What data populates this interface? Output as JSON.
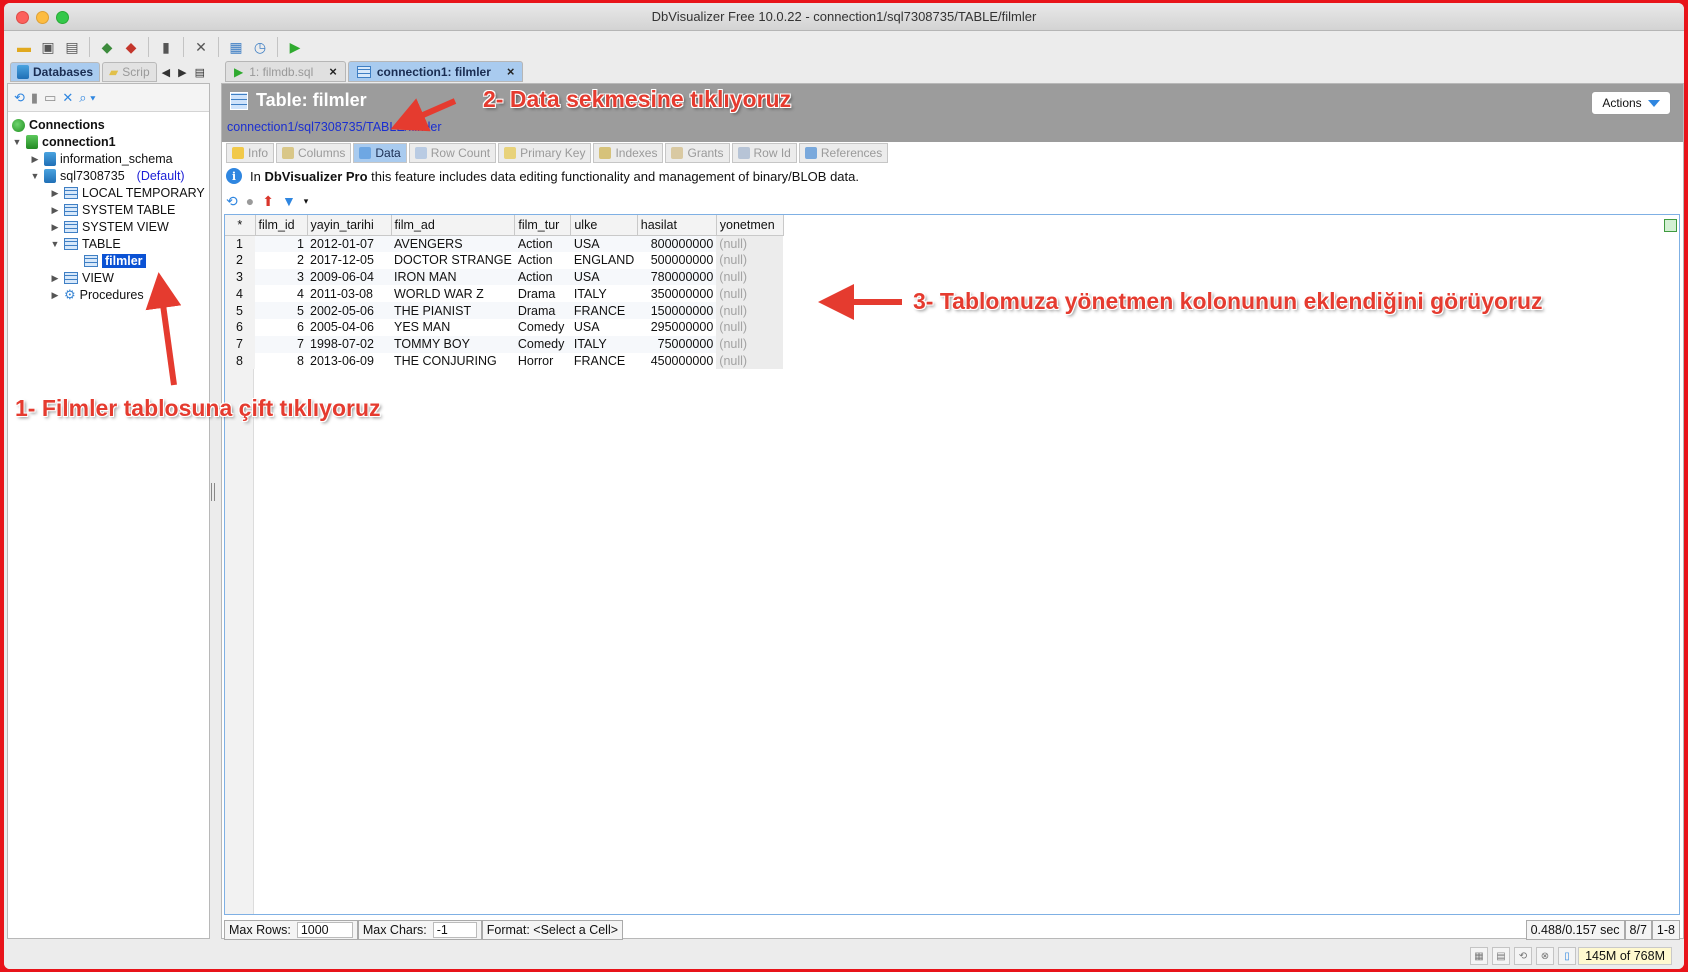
{
  "window": {
    "title": "DbVisualizer Free 10.0.22 - connection1/sql7308735/TABLE/filmler"
  },
  "left_tabs": [
    {
      "label": "Databases",
      "active": true
    },
    {
      "label": "Scrip",
      "active": false
    }
  ],
  "tree": {
    "root": "Connections",
    "connection": "connection1",
    "schema1": "information_schema",
    "schema2": "sql7308735",
    "default_tag": "(Default)",
    "nodes": [
      "LOCAL TEMPORARY",
      "SYSTEM TABLE",
      "SYSTEM VIEW",
      "TABLE",
      "VIEW",
      "Procedures"
    ],
    "selected_table": "filmler"
  },
  "doc_tabs": [
    {
      "label": "1: filmdb.sql",
      "active": false
    },
    {
      "label": "connection1: filmler",
      "active": true
    }
  ],
  "header": {
    "title": "Table: filmler",
    "path": "connection1/sql7308735/TABLE/filmler",
    "actions_label": "Actions"
  },
  "subtabs": [
    "Info",
    "Columns",
    "Data",
    "Row Count",
    "Primary Key",
    "Indexes",
    "Grants",
    "Row Id",
    "References"
  ],
  "info": {
    "prefix": "In",
    "product": "DbVisualizer Pro",
    "suffix": "this feature includes data editing functionality and management of binary/BLOB data."
  },
  "grid": {
    "corner": "*",
    "columns": [
      "film_id",
      "yayin_tarihi",
      "film_ad",
      "film_tur",
      "ulke",
      "hasilat",
      "yonetmen"
    ],
    "rows": [
      [
        "1",
        "1",
        "2012-01-07",
        "AVENGERS",
        "Action",
        "USA",
        "800000000",
        "(null)"
      ],
      [
        "2",
        "2",
        "2017-12-05",
        "DOCTOR STRANGE",
        "Action",
        "ENGLAND",
        "500000000",
        "(null)"
      ],
      [
        "3",
        "3",
        "2009-06-04",
        "IRON MAN",
        "Action",
        "USA",
        "780000000",
        "(null)"
      ],
      [
        "4",
        "4",
        "2011-03-08",
        "WORLD WAR Z",
        "Drama",
        "ITALY",
        "350000000",
        "(null)"
      ],
      [
        "5",
        "5",
        "2002-05-06",
        "THE PIANIST",
        "Drama",
        "FRANCE",
        "150000000",
        "(null)"
      ],
      [
        "6",
        "6",
        "2005-04-06",
        "YES MAN",
        "Comedy",
        "USA",
        "295000000",
        "(null)"
      ],
      [
        "7",
        "7",
        "1998-07-02",
        "TOMMY BOY",
        "Comedy",
        "ITALY",
        "75000000",
        "(null)"
      ],
      [
        "8",
        "8",
        "2013-06-09",
        "THE CONJURING",
        "Horror",
        "FRANCE",
        "450000000",
        "(null)"
      ]
    ]
  },
  "status": {
    "max_rows_label": "Max Rows:",
    "max_rows_value": "1000",
    "max_chars_label": "Max Chars:",
    "max_chars_value": "-1",
    "format_label": "Format: <Select a Cell>",
    "timing": "0.488/0.157 sec",
    "rows_count": "8/7",
    "range": "1-8"
  },
  "memory": "145M of 768M",
  "annotations": {
    "step1": "1- Filmler tablosuna çift tıklıyoruz",
    "step2": "2- Data sekmesine tıklıyoruz",
    "step3": "3- Tablomuza yönetmen kolonunun eklendiğini görüyoruz"
  },
  "colors": {
    "annotation": "#e53b2f",
    "frame": "#e8141a",
    "selection": "#0b52d4",
    "tab_active": "#a9cbef"
  }
}
